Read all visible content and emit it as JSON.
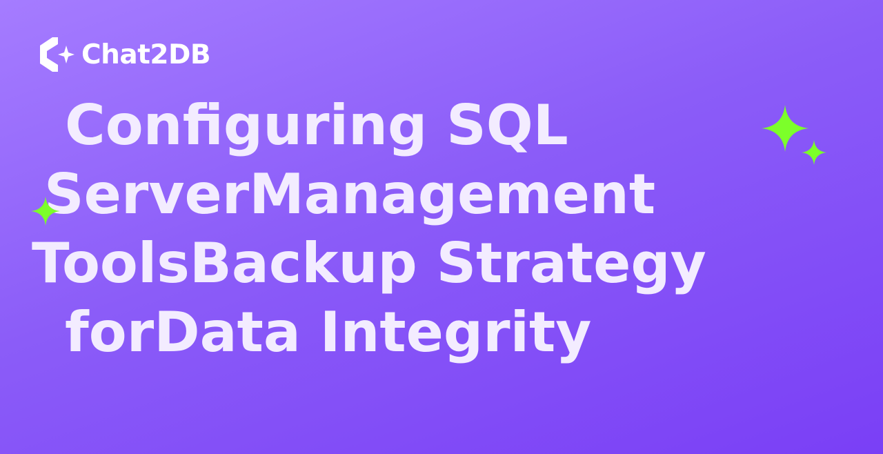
{
  "brand": {
    "name": "Chat2DB",
    "logo_icon": "chat2db-logo-icon"
  },
  "headline": {
    "lines": [
      "Configuring SQL",
      "ServerManagement",
      "ToolsBackup Strategy",
      "forData Integrity"
    ]
  },
  "colors": {
    "background_start": "#a57cff",
    "background_end": "#7a3ff6",
    "headline_text": "#f3ecff",
    "sparkle": "#7cff2a",
    "logo": "#ffffff"
  },
  "decorations": [
    "sparkle-icon",
    "sparkle-icon",
    "sparkle-icon"
  ]
}
